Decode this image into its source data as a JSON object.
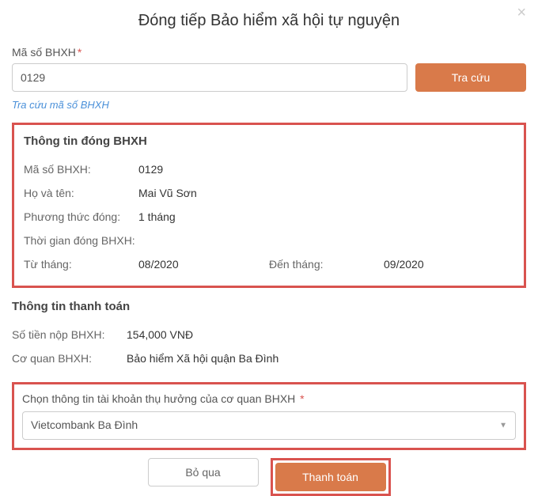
{
  "title": "Đóng tiếp Bảo hiểm xã hội tự nguyện",
  "search": {
    "label": "Mã số BHXH",
    "value": "0129",
    "button": "Tra cứu",
    "link": "Tra cứu mã số BHXH"
  },
  "info": {
    "title": "Thông tin đóng BHXH",
    "ma_so_label": "Mã số BHXH:",
    "ma_so_value": "0129",
    "ho_ten_label": "Họ và tên:",
    "ho_ten_value": "Mai Vũ Sơn",
    "phuong_thuc_label": "Phương thức đóng:",
    "phuong_thuc_value": "1 tháng",
    "thoi_gian_label": "Thời gian đóng BHXH:",
    "tu_thang_label": "Từ tháng:",
    "tu_thang_value": "08/2020",
    "den_thang_label": "Đến tháng:",
    "den_thang_value": "09/2020"
  },
  "payment": {
    "title": "Thông tin thanh toán",
    "so_tien_label": "Số tiền nộp BHXH:",
    "so_tien_value": "154,000 VNĐ",
    "co_quan_label": "Cơ quan BHXH:",
    "co_quan_value": "Bảo hiểm Xã hội quận Ba Đình"
  },
  "account": {
    "label": "Chọn thông tin tài khoản thụ hưởng của cơ quan BHXH",
    "selected": "Vietcombank Ba Đình"
  },
  "buttons": {
    "cancel": "Bỏ qua",
    "pay": "Thanh toán"
  }
}
